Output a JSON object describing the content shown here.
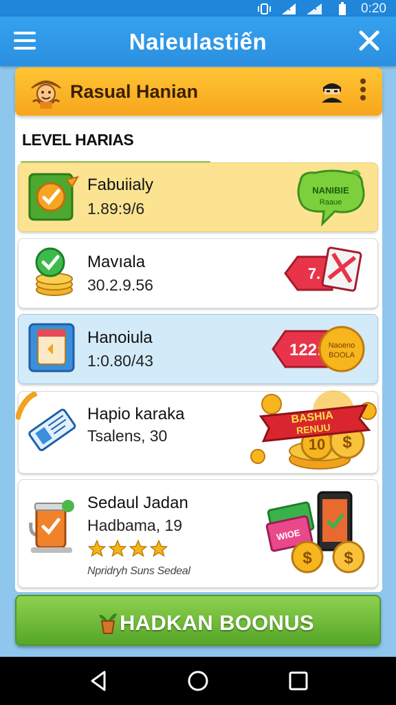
{
  "status_bar": {
    "time": "0:20"
  },
  "app_bar": {
    "title": "Naieulastiến"
  },
  "header": {
    "title": "Rasual Hanian"
  },
  "section": {
    "title": "LEVEL HARIAS"
  },
  "rows": [
    {
      "name": "Fabuiialy",
      "value": "1.89:9/6",
      "badge_line1": "NANIBIE",
      "badge_line2": "Raaue"
    },
    {
      "name": "Mavıala",
      "value": "30.2.9.56",
      "tag_text": "7."
    },
    {
      "name": "Hanoiula",
      "value": "1:0.80/43",
      "tag_text": "122:",
      "coin_line1": "Naoeno",
      "coin_line2": "BOOLA"
    },
    {
      "name": "Hapio karaka",
      "value": "Tsalens, 30",
      "ribbon_line1": "BASHIA",
      "ribbon_line2": "RENUU",
      "coin_number": "10"
    },
    {
      "name": "Sedaul Jadan",
      "value": "Hadbama, 19",
      "rating": 4,
      "note": "Npridryh Suns Sedeal",
      "card_text": "WIOE"
    }
  ],
  "bonus_button": {
    "label": "HADKAN BOONUS"
  },
  "colors": {
    "app_bar": "#2b8fe0",
    "header": "#f7a51c",
    "accent_green": "#56a628",
    "star": "#f5b417"
  }
}
